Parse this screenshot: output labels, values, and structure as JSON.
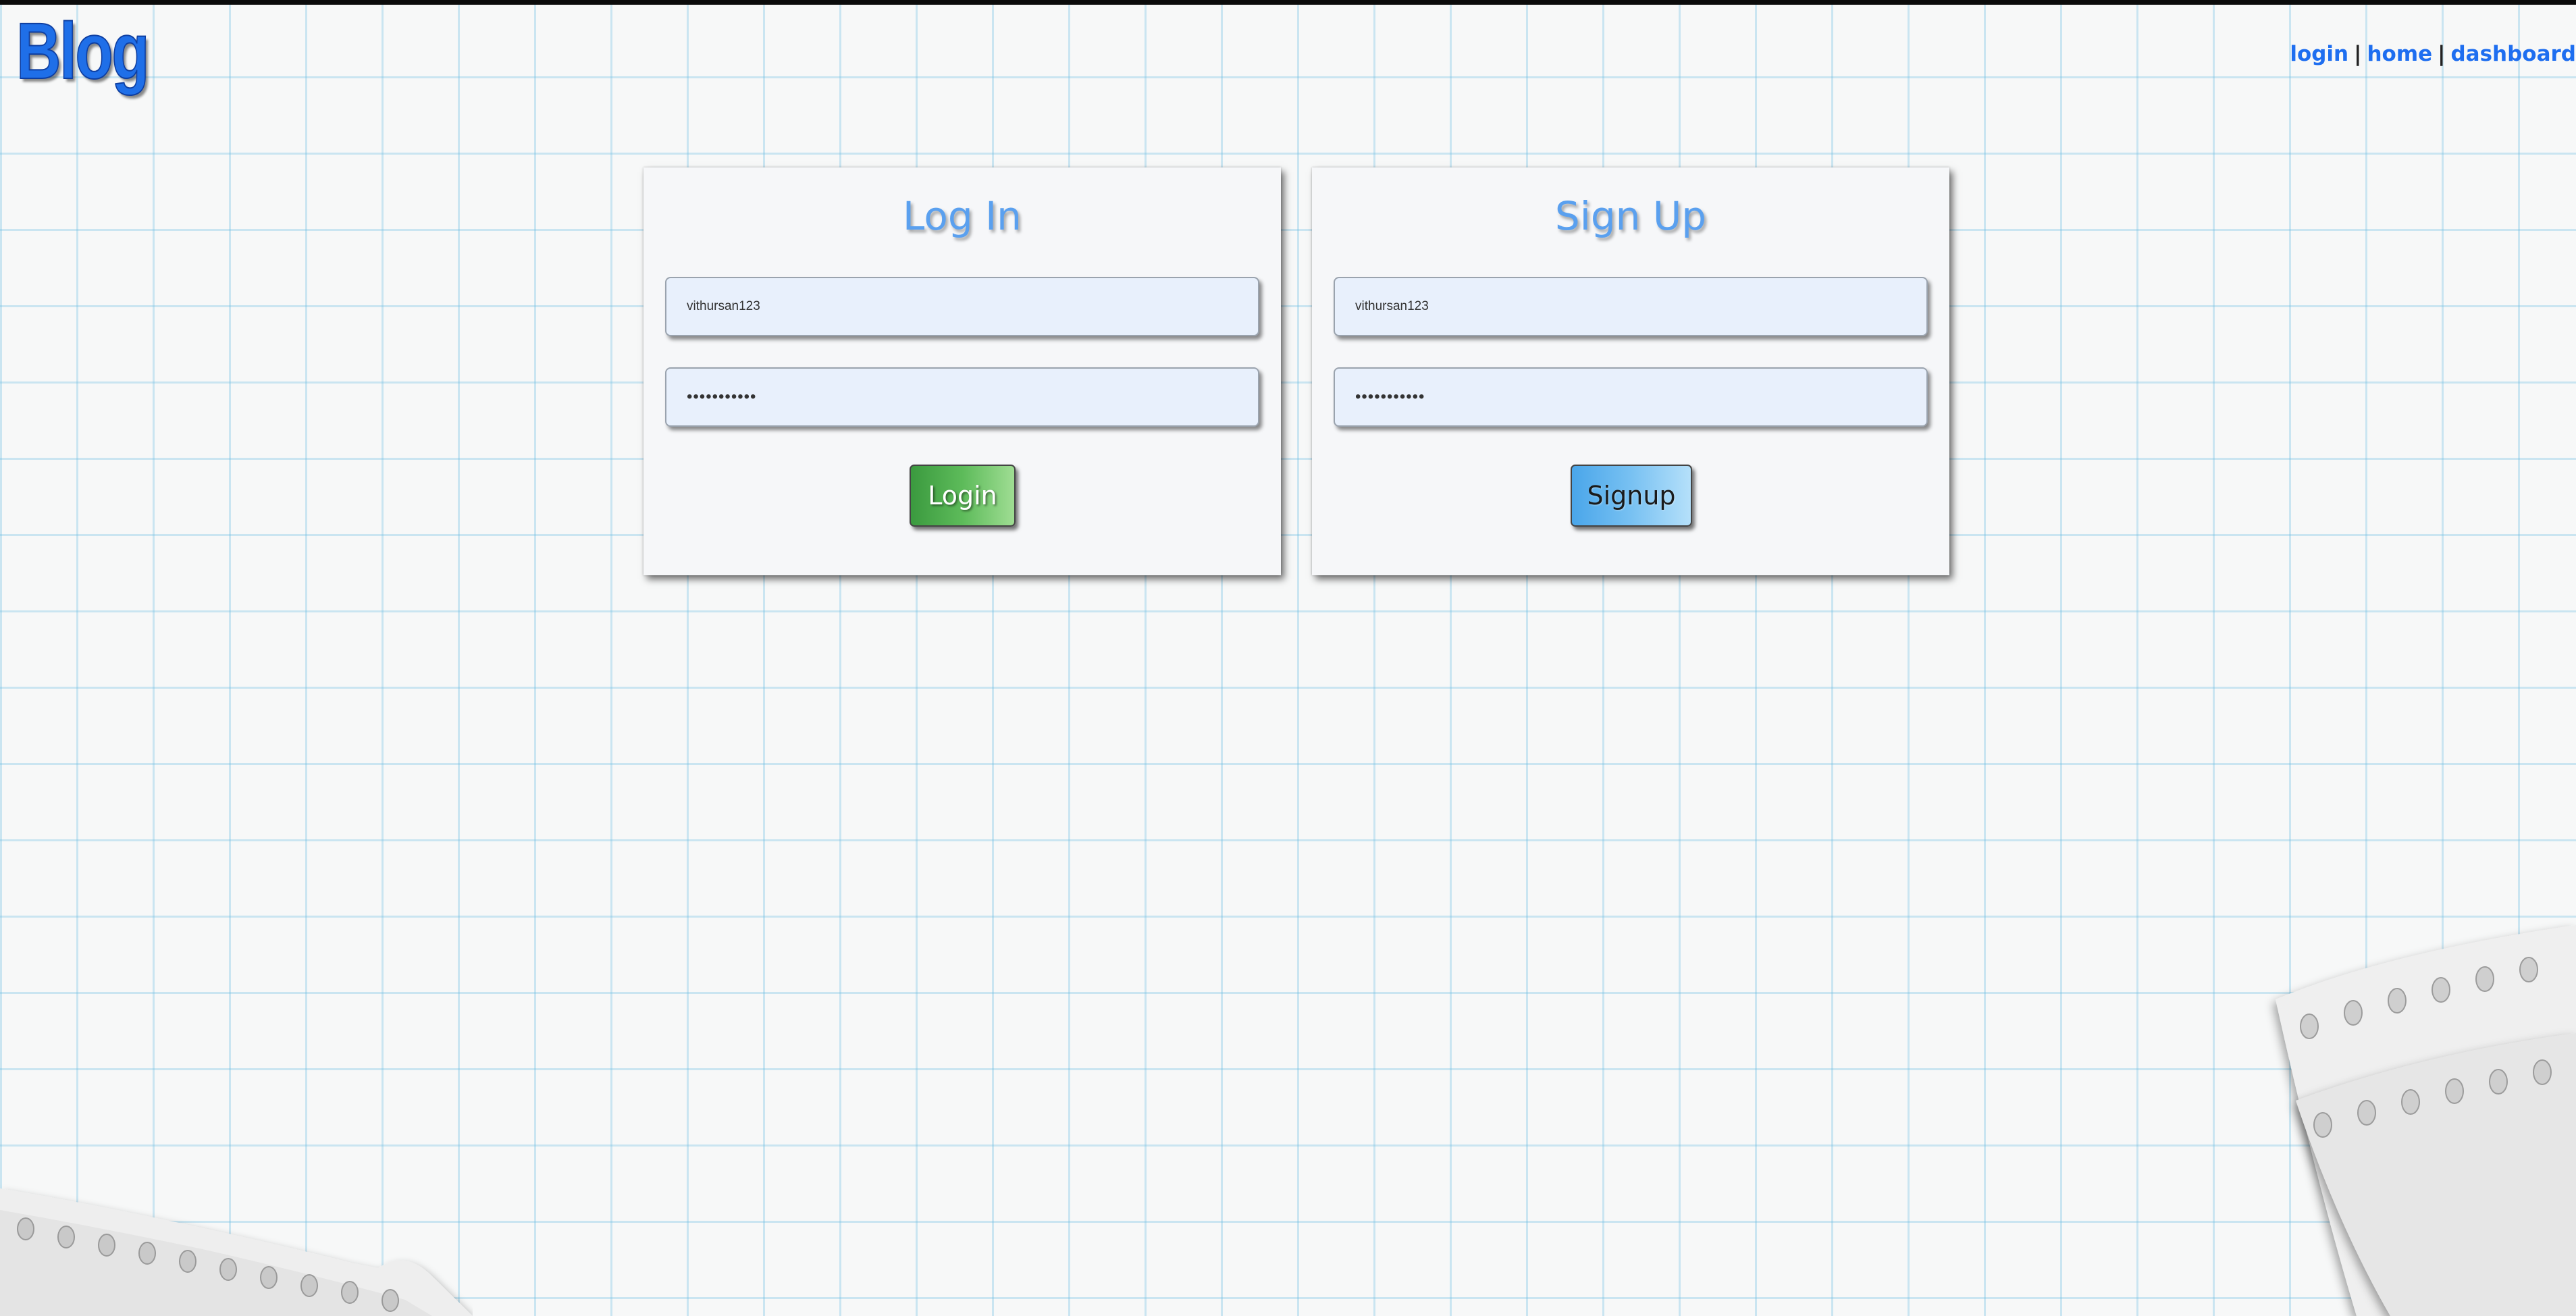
{
  "header": {
    "brand": "Blog",
    "nav": {
      "login": "login",
      "separator": "|",
      "home": "home",
      "dashboard": "dashboard"
    }
  },
  "login_card": {
    "title": "Log In",
    "username_value": "vithursan123",
    "password_value": "password123",
    "button_label": "Login"
  },
  "signup_card": {
    "title": "Sign Up",
    "username_value": "vithursan123",
    "password_value": "password123",
    "button_label": "Signup"
  },
  "colors": {
    "brand": "#1f6fe8",
    "nav_link": "#1e6ef0",
    "card_title": "#5aa0ef",
    "login_button": "#5dbb5a",
    "signup_button": "#78c1f2",
    "grid_line": "#64b9e1"
  },
  "decorations": {
    "bottom_left": "torn-notebook-paper-icon",
    "bottom_right": "torn-notebook-paper-icon"
  }
}
